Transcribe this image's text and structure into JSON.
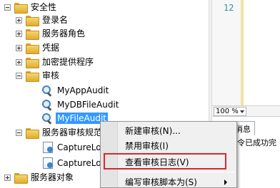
{
  "tree": {
    "items": [
      {
        "label": "安全性",
        "expand": "minus",
        "icon": "folder-icon",
        "name": "tree-node-security"
      },
      {
        "label": "登录名",
        "expand": "plus",
        "icon": "folder-icon",
        "name": "tree-node-logins"
      },
      {
        "label": "服务器角色",
        "expand": "plus",
        "icon": "folder-icon",
        "name": "tree-node-server-roles"
      },
      {
        "label": "凭据",
        "expand": "plus",
        "icon": "folder-icon",
        "name": "tree-node-credentials"
      },
      {
        "label": "加密提供程序",
        "expand": "plus",
        "icon": "folder-icon",
        "name": "tree-node-crypto-providers"
      },
      {
        "label": "审核",
        "expand": "minus",
        "icon": "folder-icon",
        "name": "tree-node-audits"
      },
      {
        "label": "MyAppAudit",
        "expand": "",
        "icon": "audit-icon",
        "name": "tree-node-myappaudit"
      },
      {
        "label": "MyDBFileAudit",
        "expand": "",
        "icon": "audit-icon",
        "name": "tree-node-mydbfileaudit"
      },
      {
        "label": "MyFileAudit",
        "expand": "",
        "icon": "audit-icon",
        "name": "tree-node-myfileaudit"
      },
      {
        "label": "服务器审核规范",
        "expand": "minus",
        "icon": "folder-icon",
        "name": "tree-node-server-audit-specs"
      },
      {
        "label": "CaptureLo",
        "expand": "",
        "icon": "audit-spec-icon",
        "name": "tree-node-capturelo-1"
      },
      {
        "label": "CaptureLo",
        "expand": "",
        "icon": "audit-spec-icon",
        "name": "tree-node-capturelo-2"
      },
      {
        "label": "服务器对象",
        "expand": "plus",
        "icon": "folder-icon",
        "name": "tree-node-server-objects"
      }
    ]
  },
  "editor": {
    "line_number": "12"
  },
  "statusbar": {
    "zoom": "100 %"
  },
  "results": {
    "tab_label": "消息",
    "message": "命令已成功完"
  },
  "context_menu": {
    "items": [
      {
        "label": "新建审核(N)..."
      },
      {
        "label": "禁用审核(I)"
      },
      {
        "label": "查看审核日志(V)"
      },
      {
        "label": "编写审核脚本为(S)"
      }
    ]
  },
  "colors": {
    "selection": "#3399ff",
    "highlight_border": "#d8282e",
    "line_number": "#2b91af"
  }
}
